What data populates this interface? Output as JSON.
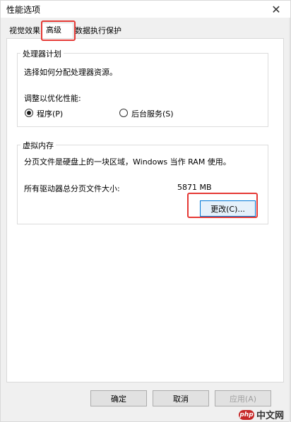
{
  "window": {
    "title": "性能选项",
    "close_glyph": "✕"
  },
  "tabs": [
    {
      "label": "视觉效果"
    },
    {
      "label": "高级"
    },
    {
      "label": "数据执行保护"
    }
  ],
  "processor_group": {
    "legend": "处理器计划",
    "description": "选择如何分配处理器资源。",
    "adjust_label": "调整以优化性能:",
    "option_programs": "程序(P)",
    "option_background": "后台服务(S)",
    "selected": "程序(P)"
  },
  "virtual_memory_group": {
    "legend": "虚拟内存",
    "description": "分页文件是硬盘上的一块区域，Windows 当作 RAM 使用。",
    "total_label": "所有驱动器总分页文件大小:",
    "total_value": "5871 MB",
    "change_button": "更改(C)..."
  },
  "footer": {
    "ok": "确定",
    "cancel": "取消",
    "apply": "应用(A)"
  },
  "watermark": {
    "badge": "php",
    "text": "中文网"
  },
  "colors": {
    "highlight": "#e53935",
    "accent": "#0078d7"
  }
}
